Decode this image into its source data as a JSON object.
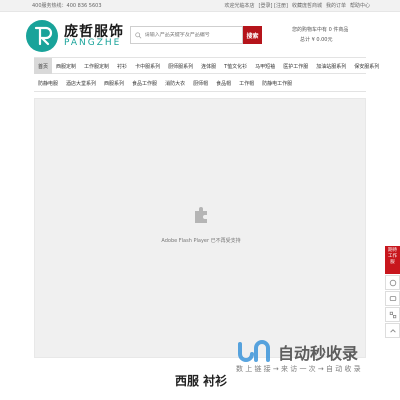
{
  "topbar": {
    "hotline": "400服务热线：400 836 5603",
    "links": [
      "欢迎光临本店",
      "[登录] [注册]",
      "收藏庞哲商城",
      "我的订单",
      "帮助中心"
    ]
  },
  "brand": {
    "name_cn": "庞哲服饰",
    "name_en": "PANGZHE"
  },
  "search": {
    "placeholder": "请输入产品关键字及产品编号",
    "button_label": "搜索"
  },
  "cart": {
    "line1": "您的购物车中有 0 件商品",
    "line2": "总计 ¥ 0.00元"
  },
  "nav": {
    "row1": [
      "首页",
      "西服定制",
      "工作服定制",
      "衬衫",
      "卡中服系列",
      "厨师服系列",
      "连体服",
      "T恤文化衫",
      "马甲短袖",
      "医护工作服",
      "加油站服系列",
      "保安服系列"
    ],
    "row2": [
      "防静电服",
      "酒店大堂系列",
      "西服系列",
      "食品工作服",
      "消防大衣",
      "厨师帽",
      "食品帽",
      "工作帽",
      "防静电工作服"
    ]
  },
  "flash": {
    "message": "Adobe Flash Player 已不再受支持"
  },
  "side_float": {
    "label": "期待工作服"
  },
  "section": {
    "title": "西服 衬衫"
  },
  "watermark": {
    "title": "自动秒收录",
    "subtitle": "数 上 链 接 → 来 访 一 次 → 自 动 收 录"
  },
  "colors": {
    "brand_teal": "#19a39a",
    "accent_red": "#b5141b"
  }
}
